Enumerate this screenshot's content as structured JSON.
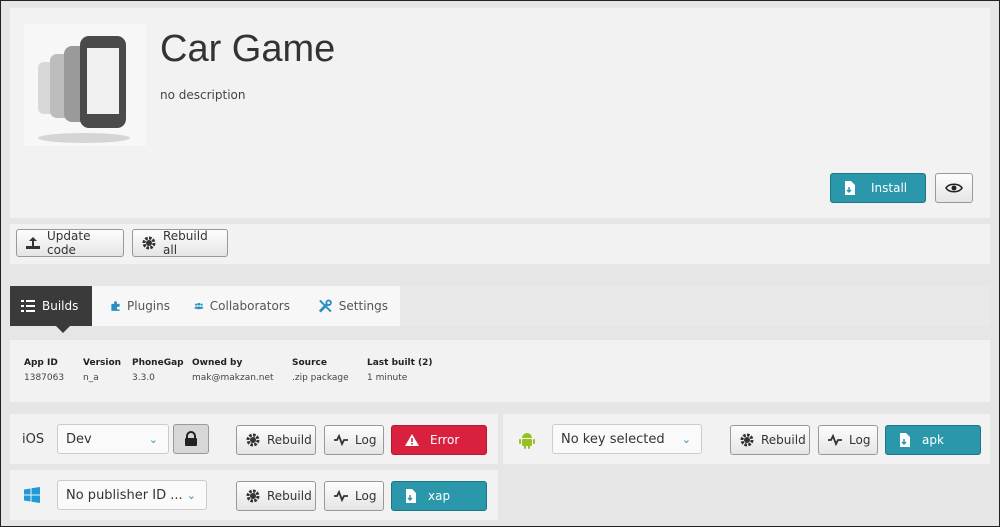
{
  "app": {
    "title": "Car Game",
    "description": "no description"
  },
  "header_actions": {
    "install_label": "Install",
    "preview_icon": "eye-icon"
  },
  "toolbar": {
    "update_code_label": "Update code",
    "rebuild_all_label": "Rebuild all"
  },
  "tabs": [
    {
      "label": "Builds",
      "icon": "list-icon",
      "active": true
    },
    {
      "label": "Plugins",
      "icon": "puzzle-icon",
      "active": false
    },
    {
      "label": "Collaborators",
      "icon": "users-icon",
      "active": false
    },
    {
      "label": "Settings",
      "icon": "tools-icon",
      "active": false
    }
  ],
  "info": {
    "headers": [
      "App ID",
      "Version",
      "PhoneGap",
      "Owned by",
      "Source",
      "Last built (2)"
    ],
    "values": [
      "1387063",
      "n_a",
      "3.3.0",
      "mak@makzan.net",
      ".zip package",
      "1 minute"
    ]
  },
  "platforms": {
    "ios": {
      "label": "iOS",
      "key": "Dev",
      "rebuild": "Rebuild",
      "log": "Log",
      "status": "Error"
    },
    "android": {
      "key": "No key selected",
      "rebuild": "Rebuild",
      "log": "Log",
      "status": "apk"
    },
    "windows": {
      "key": "No publisher ID ...",
      "rebuild": "Rebuild",
      "log": "Log",
      "status": "xap"
    }
  },
  "colors": {
    "teal": "#2a97ab",
    "red": "#d9203e",
    "dark_tab": "#3a3a3a",
    "android_green": "#97c024",
    "windows_blue": "#1f9ad6"
  }
}
